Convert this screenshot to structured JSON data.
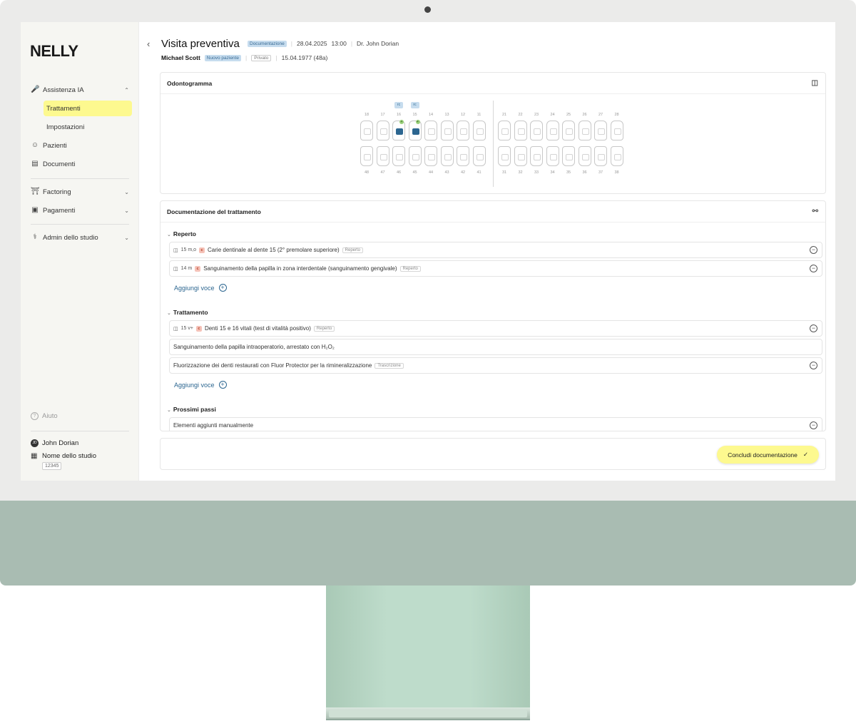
{
  "sidebar": {
    "logo": "NELLY",
    "items": [
      {
        "label": "Assistenza IA",
        "icon": "microphone-icon"
      },
      {
        "label": "Trattamenti"
      },
      {
        "label": "Impostazioni"
      },
      {
        "label": "Pazienti",
        "icon": "users-icon"
      },
      {
        "label": "Documenti",
        "icon": "document-icon"
      },
      {
        "label": "Factoring",
        "icon": "bank-icon"
      },
      {
        "label": "Pagamenti",
        "icon": "money-icon"
      },
      {
        "label": "Admin dello studio",
        "icon": "stethoscope-icon"
      }
    ],
    "help": "Aiuto",
    "user_initials": "JD",
    "user_name": "John Dorian",
    "studio_name": "Nome dello studio",
    "studio_id": "12345"
  },
  "header": {
    "title": "Visita preventiva",
    "status_badge": "Documentazione",
    "date": "28.04.2025",
    "time": "13:00",
    "doctor": "Dr. John Dorian",
    "patient_name": "Michael Scott",
    "patient_badge": "Nuovo paziente",
    "insurance": "Privato",
    "birthdate": "15.04.1977 (48a)"
  },
  "odontogram": {
    "title": "Odontogramma",
    "upper_right": [
      "18",
      "17",
      "16",
      "15",
      "14",
      "13",
      "12",
      "11"
    ],
    "upper_left": [
      "21",
      "22",
      "23",
      "24",
      "25",
      "26",
      "27",
      "28"
    ],
    "lower_right": [
      "48",
      "47",
      "46",
      "45",
      "44",
      "43",
      "42",
      "41"
    ],
    "lower_left": [
      "31",
      "32",
      "33",
      "34",
      "35",
      "36",
      "37",
      "38"
    ],
    "rc_label": "rc"
  },
  "documentation": {
    "title": "Documentazione del trattamento",
    "section_reperto": "Reperto",
    "section_trattamento": "Trattamento",
    "section_prossimi": "Prossimi passi",
    "add_label": "Aggiungi voce",
    "c_badge": "c",
    "rows": [
      {
        "code": "15 m,o",
        "text": "Carie dentinale al dente 15 (2° premolare superiore)",
        "source": "Reperto"
      },
      {
        "code": "14 m",
        "text": "Sanguinamento della papilla in zona interdentale (sanguinamento gengivale)",
        "source": "Reperto"
      },
      {
        "code": "15 v+",
        "text": "Denti 15 e 16 vitali (test di vitalità positivo)",
        "source": "Reperto"
      },
      {
        "text": "Sanguinamento della papilla intraoperatorio, arrestato con H₂O₂"
      },
      {
        "text": "Fluorizzazione dei denti restaurati con Fluor Protector per la rimineralizzazione",
        "source": "Trascrizione"
      },
      {
        "text": "Elementi aggiunti manualmente"
      }
    ]
  },
  "footer": {
    "conclude_label": "Concludi documentazione"
  }
}
